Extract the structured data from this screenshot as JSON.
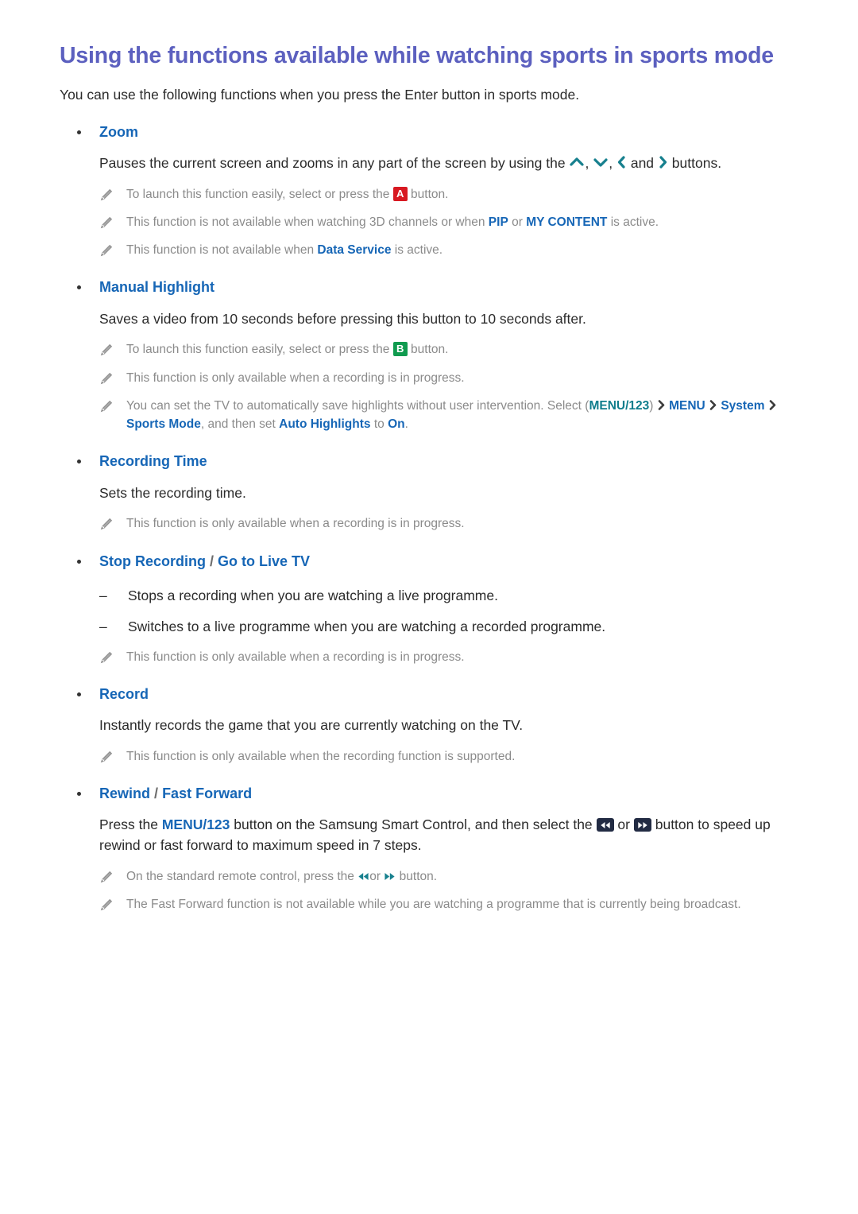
{
  "document": {
    "title": "Using the functions available while watching sports in sports mode",
    "intro": "You can use the following functions when you press the Enter button in sports mode."
  },
  "sections": [
    {
      "label": "Zoom",
      "body_before_icons": "Pauses the current screen and zooms in any part of the screen by using the",
      "body_after_icons": "buttons.",
      "icon_names": [
        "chevron-up-icon",
        "chevron-down-icon",
        "chevron-left-icon",
        "chevron-right-icon"
      ],
      "notes": [
        {
          "pre": "To launch this function easily, select or press the",
          "badge": "A",
          "badge_color": "#d81921",
          "post": "button."
        },
        {
          "pre": "This function is not available when watching 3D channels or when",
          "kw1": "PIP",
          "mid": "or",
          "kw2": "MY CONTENT",
          "post": "is active."
        },
        {
          "pre": "This function is not available when",
          "kw1": "Data Service",
          "post": "is active."
        }
      ]
    },
    {
      "label": "Manual Highlight",
      "body": "Saves a video from 10 seconds before pressing this button to 10 seconds after.",
      "notes": [
        {
          "pre": "To launch this function easily, select or press the",
          "badge": "B",
          "badge_color": "#109b4f",
          "post": "button."
        },
        {
          "text": "This function is only available when a recording is in progress."
        },
        {
          "pre": "You can set the TV to automatically save highlights without user intervention. Select (",
          "kw_menu123": "MENU/123",
          "mid_paren": ")",
          "kw_menu": "MENU",
          "kw_system": "System",
          "kw_sports": "Sports Mode",
          "mid_text": ", and then set",
          "kw_auto": "Auto Highlights",
          "to_text": "to",
          "kw_on": "On",
          "post": "."
        }
      ]
    },
    {
      "label": "Recording Time",
      "body": "Sets the recording time.",
      "notes": [
        {
          "text": "This function is only available when a recording is in progress."
        }
      ]
    },
    {
      "label": "Stop Recording",
      "label_sep": "/",
      "label2": "Go to Live TV",
      "dashes": [
        "Stops a recording when you are watching a live programme.",
        "Switches to a live programme when you are watching a recorded programme."
      ],
      "notes": [
        {
          "text": "This function is only available when a recording is in progress."
        }
      ]
    },
    {
      "label": "Record",
      "body": "Instantly records the game that you are currently watching on the TV.",
      "notes": [
        {
          "text": "This function is only available when the recording function is supported."
        }
      ]
    },
    {
      "label": "Rewind",
      "label_sep": "/",
      "label2": "Fast Forward",
      "body_parts": {
        "p1": "Press the",
        "kw_menu123": "MENU/123",
        "p2": "button on the Samsung Smart Control, and then select the",
        "or": "or",
        "p3": "button to speed up rewind or fast forward to maximum speed in 7 steps."
      },
      "notes": [
        {
          "pre": "On the standard remote control, press the",
          "or": "or",
          "post": "button."
        },
        {
          "text": "The Fast Forward function is not available while you are watching a programme that is currently being broadcast."
        }
      ]
    }
  ],
  "colors": {
    "title": "#5c60bf",
    "link_blue": "#1666b6",
    "teal": "#0f7d8c",
    "note_gray": "#8b8b8b",
    "body": "#2b2b2b",
    "badge_red": "#d81921",
    "badge_green": "#109b4f",
    "transport_badge": "#222b43"
  },
  "icons": {
    "note": "pencil-icon",
    "rewind": "rewind-icon",
    "fast_forward": "fast-forward-icon",
    "nav_chevron": "chevron-right-icon"
  }
}
